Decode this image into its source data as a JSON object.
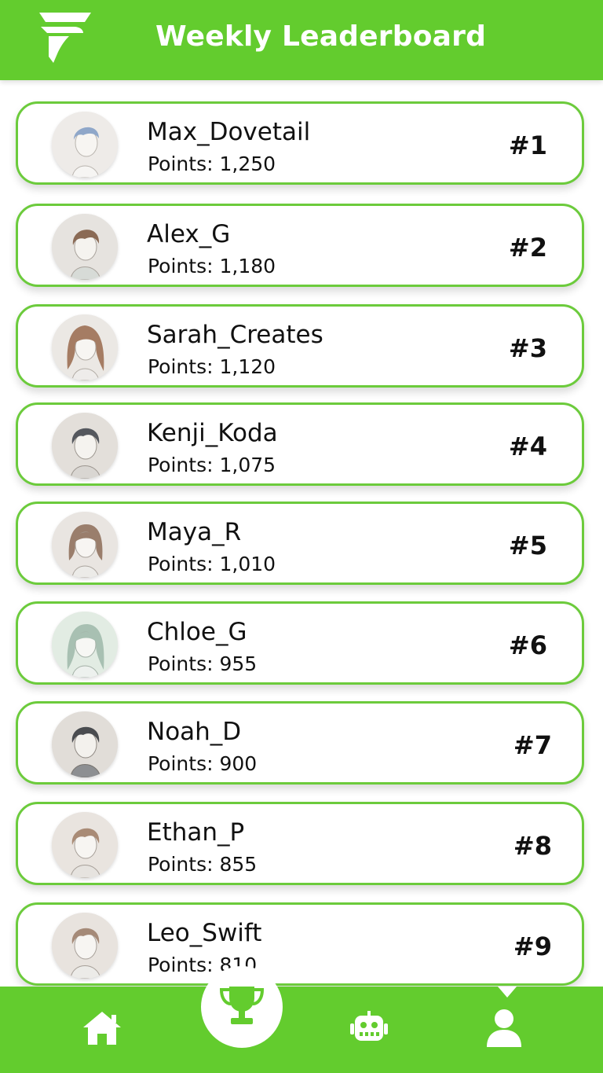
{
  "header": {
    "title": "Weekly Leaderboard",
    "logo_icon": "swift-logo-icon"
  },
  "colors": {
    "brand_green": "#63cc2e",
    "card_border": "#6ccb3c",
    "text": "#111111"
  },
  "leaderboard": [
    {
      "username": "Max_Dovetail",
      "points": "Points: 1,250",
      "rank": "#1"
    },
    {
      "username": "Alex_G",
      "points": "Points: 1,180",
      "rank": "#2"
    },
    {
      "username": "Sarah_Creates",
      "points": "Points: 1,120",
      "rank": "#3"
    },
    {
      "username": "Kenji_Koda",
      "points": "Points: 1,075",
      "rank": "#4"
    },
    {
      "username": "Maya_R",
      "points": "Points: 1,010",
      "rank": "#5"
    },
    {
      "username": "Chloe_G",
      "points": "Points: 955",
      "rank": "#6"
    },
    {
      "username": "Noah_D",
      "points": "Points: 900",
      "rank": "#7"
    },
    {
      "username": "Ethan_P",
      "points": "Points: 855",
      "rank": "#8"
    },
    {
      "username": "Leo_Swift",
      "points": "Points: 810",
      "rank": "#9"
    }
  ],
  "bottom_nav": {
    "items": [
      "home-icon",
      "trophy-icon",
      "robot-icon",
      "profile-icon"
    ],
    "active": "trophy-icon"
  }
}
